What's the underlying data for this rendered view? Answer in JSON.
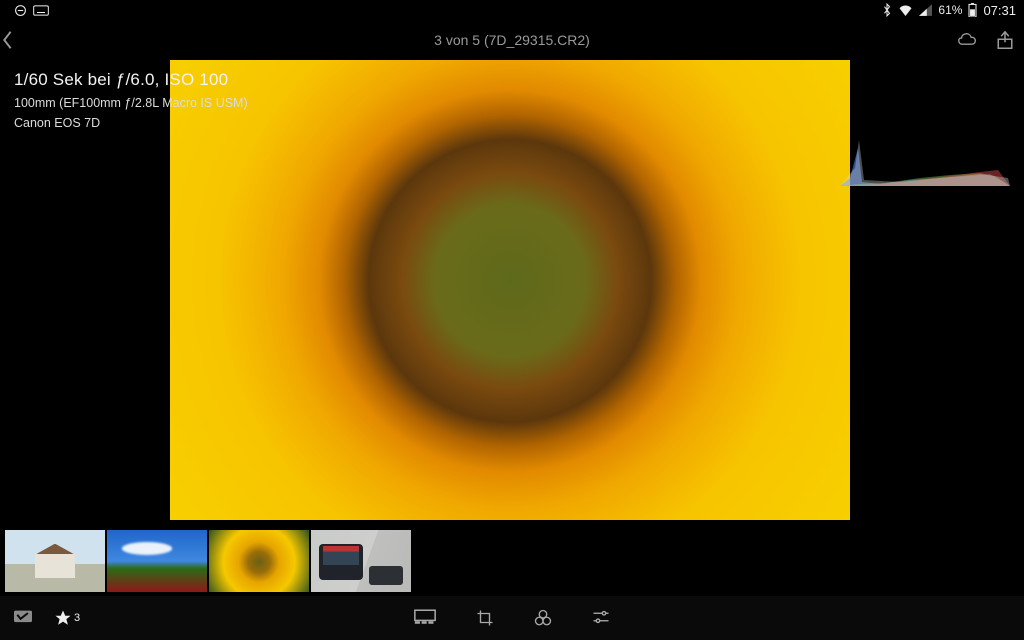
{
  "status": {
    "battery_percent": "61%",
    "time": "07:31"
  },
  "header": {
    "title": "3 von 5 (7D_29315.CR2)"
  },
  "meta": {
    "exposure": "1/60 Sek bei ƒ/6.0, ISO 100",
    "lens": "100mm (EF100mm ƒ/2.8L Macro IS USM)",
    "camera": "Canon EOS 7D"
  },
  "rating": {
    "stars_label": "3"
  },
  "thumbs": [
    {
      "name": "thumb-1",
      "selected": false
    },
    {
      "name": "thumb-2",
      "selected": false
    },
    {
      "name": "thumb-3",
      "selected": true
    },
    {
      "name": "thumb-4",
      "selected": false
    }
  ]
}
